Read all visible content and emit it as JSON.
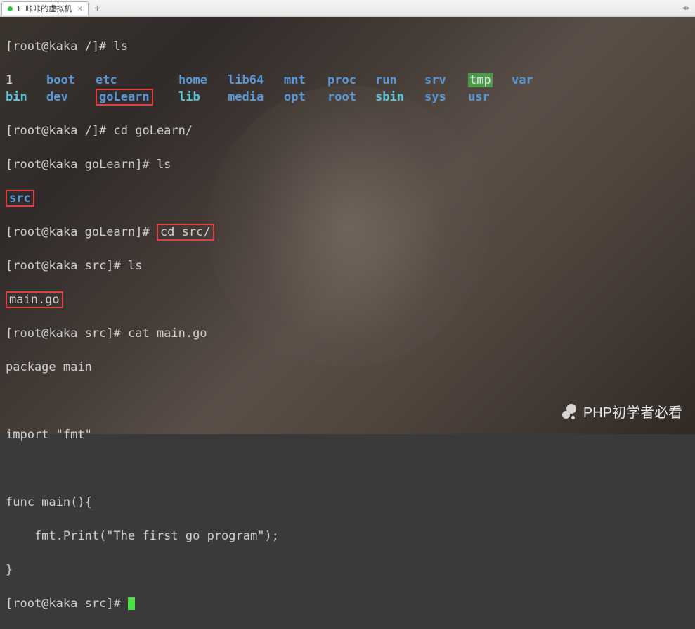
{
  "tabs": {
    "active": {
      "index": "1",
      "title": "咔咔的虚拟机"
    }
  },
  "terminal": {
    "prompt_root_slash": "[root@kaka /]# ",
    "prompt_root_golearn": "[root@kaka goLearn]# ",
    "prompt_root_src": "[root@kaka src]# ",
    "cmd_ls": "ls",
    "cmd_cd_golearn": "cd goLearn/",
    "cmd_cd_src": "cd src/",
    "cmd_cat": "cat main.go",
    "ls_root_row1": [
      "1",
      "boot",
      "etc",
      "home",
      "lib64",
      "mnt",
      "proc",
      "run",
      "srv",
      "tmp",
      "var"
    ],
    "ls_root_row2": [
      "bin",
      "dev",
      "goLearn",
      "lib",
      "media",
      "opt",
      "root",
      "sbin",
      "sys",
      "usr",
      ""
    ],
    "ls_golearn": "src",
    "ls_src": "main.go",
    "code": {
      "l1": "package main",
      "l2": "",
      "l3": "import \"fmt\"",
      "l4": "",
      "l5": "func main(){",
      "l6": "    fmt.Print(\"The first go program\");",
      "l7": "}"
    }
  },
  "watermark": "PHP初学者必看"
}
